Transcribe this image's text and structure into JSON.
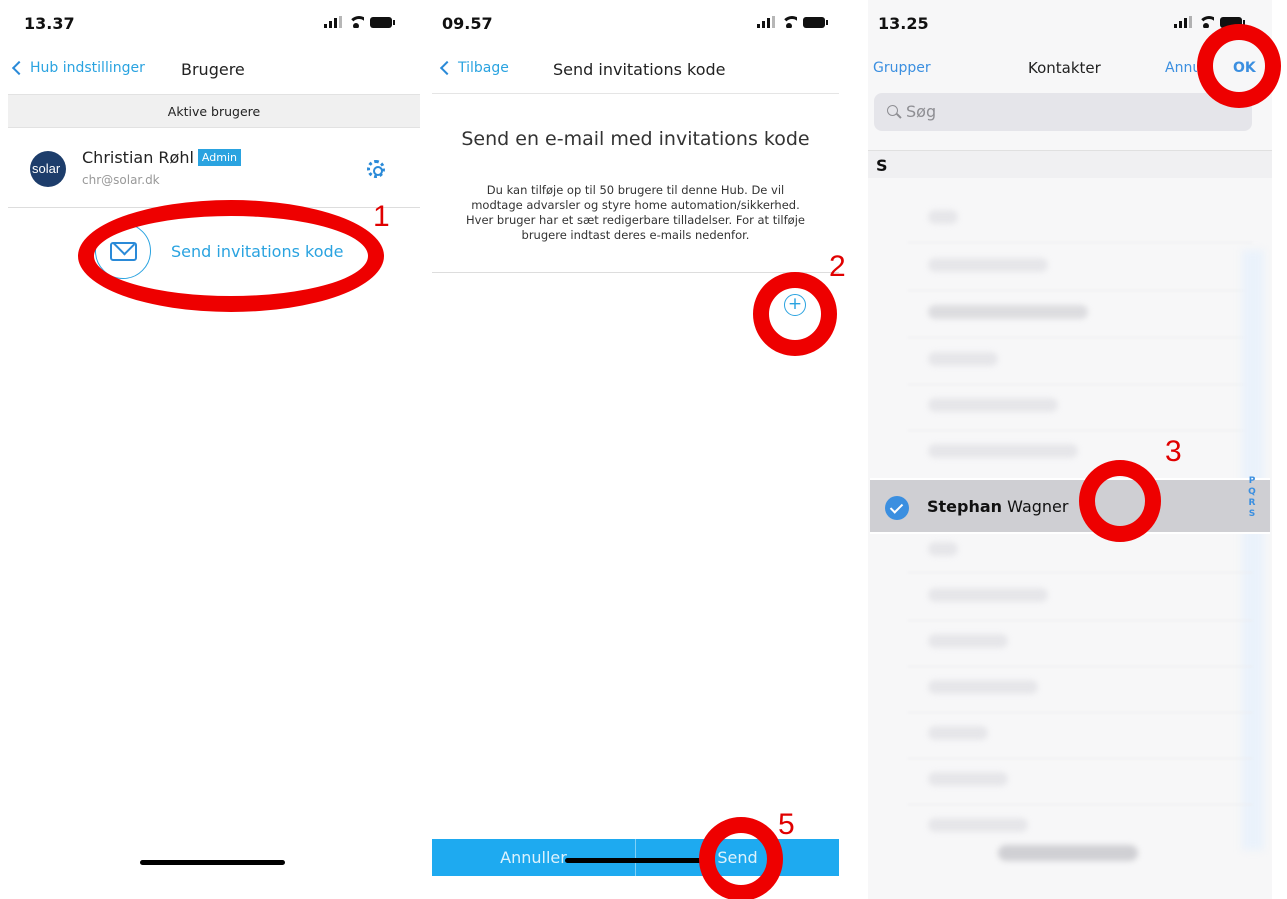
{
  "screen1": {
    "time": "13.37",
    "back_label": "Hub indstillinger",
    "title": "Brugere",
    "section_header": "Aktive brugere",
    "user": {
      "avatar_text": "solar",
      "name": "Christian Røhl",
      "badge": "Admin",
      "email": "chr@solar.dk"
    },
    "invite_label": "Send invitations kode",
    "icons": [
      "location-arrow-icon",
      "signal-icon",
      "wifi-icon",
      "battery-icon",
      "chevron-left-icon",
      "gear-icon",
      "envelope-icon"
    ]
  },
  "screen2": {
    "time": "09.57",
    "back_label": "Tilbage",
    "title": "Send invitations kode",
    "heading": "Send en e-mail med invitations kode",
    "description": "Du kan tilføje op til 50 brugere til denne Hub. De vil modtage advarsler og styre home automation/sikkerhed. Hver bruger har et sæt redigerbare tilladelser. For at tilføje brugere indtast deres e-mails nedenfor.",
    "add_symbol": "+",
    "cancel_label": "Annuller",
    "send_label": "Send",
    "icons": [
      "plus-circle-icon"
    ]
  },
  "screen3": {
    "time": "13.25",
    "groups_label": "Grupper",
    "title": "Kontakter",
    "cancel_label": "Annuller",
    "ok_label": "OK",
    "search_placeholder": "Søg",
    "section_letter": "S",
    "selected_contact": {
      "first_name": "Stephan",
      "last_name": " Wagner"
    },
    "index_letters": [
      "P",
      "Q",
      "R",
      "S"
    ],
    "icons": [
      "search-icon",
      "checkmark-circle-icon"
    ]
  },
  "annotations": {
    "step1": "1",
    "step2": "2",
    "step3": "3",
    "step5": "5",
    "color": "#ee0000"
  },
  "colors": {
    "accent": "#2aa3e0",
    "ios_blue": "#3b8fe0",
    "button_bar": "#1eaaf0",
    "avatar_bg": "#1d3d6b"
  }
}
